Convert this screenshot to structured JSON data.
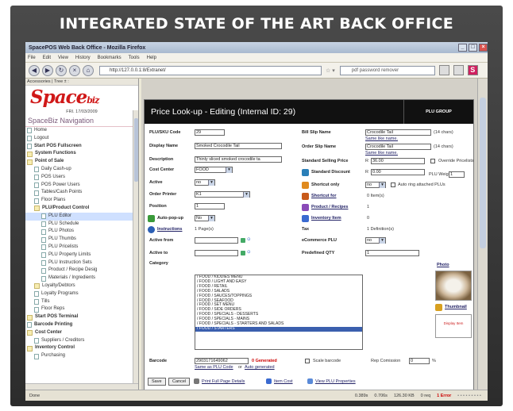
{
  "banner": {
    "title": "INTEGRATED STATE OF THE ART BACK OFFICE"
  },
  "browser": {
    "window_title": "SpacePOS Web Back Office - Mozilla Firefox",
    "menus": [
      "File",
      "Edit",
      "View",
      "History",
      "Bookmarks",
      "Tools",
      "Help"
    ],
    "url": "http://127.0.0.1:8/Extranet/",
    "search": "pdf password remover"
  },
  "sidebar": {
    "header": "Accessories | Tree ± :",
    "logo_main": "Space",
    "logo_sub": "biz",
    "date": "FRI. 17/03/2009",
    "nav_title": "SpaceBiz Navigation",
    "items": [
      {
        "label": "Home",
        "kind": "doc",
        "indent": 1
      },
      {
        "label": "Logout",
        "kind": "doc",
        "indent": 1
      },
      {
        "label": "Start POS Fullscreen",
        "kind": "doc",
        "indent": 1,
        "bold": true
      },
      {
        "label": "System Functions",
        "kind": "folder",
        "indent": 1,
        "bold": true
      },
      {
        "label": "Point of Sale",
        "kind": "folder",
        "indent": 1,
        "bold": true
      },
      {
        "label": "Daily Cash-up",
        "kind": "doc",
        "indent": 2
      },
      {
        "label": "POS Users",
        "kind": "doc",
        "indent": 2
      },
      {
        "label": "POS Power Users",
        "kind": "doc",
        "indent": 2
      },
      {
        "label": "Tables/Cash Points",
        "kind": "doc",
        "indent": 2
      },
      {
        "label": "Floor Plans",
        "kind": "doc",
        "indent": 2
      },
      {
        "label": "PLU/Product Control",
        "kind": "folder",
        "indent": 2,
        "bold": true
      },
      {
        "label": "PLU Editor",
        "kind": "doc",
        "indent": 3,
        "selected": true
      },
      {
        "label": "PLU Schedule",
        "kind": "doc",
        "indent": 3
      },
      {
        "label": "PLU Photos",
        "kind": "doc",
        "indent": 3
      },
      {
        "label": "PLU Thumbs",
        "kind": "doc",
        "indent": 3
      },
      {
        "label": "PLU Pricelists",
        "kind": "doc",
        "indent": 3
      },
      {
        "label": "PLU Property Limits",
        "kind": "doc",
        "indent": 3
      },
      {
        "label": "PLU Instruction Sets",
        "kind": "doc",
        "indent": 3
      },
      {
        "label": "Product / Recipe Desig",
        "kind": "doc",
        "indent": 3
      },
      {
        "label": "Materials / Ingredients",
        "kind": "doc",
        "indent": 3
      },
      {
        "label": "Loyalty/Debtors",
        "kind": "folder",
        "indent": 2
      },
      {
        "label": "Loyalty Programs",
        "kind": "doc",
        "indent": 2
      },
      {
        "label": "Tills",
        "kind": "doc",
        "indent": 2
      },
      {
        "label": "Floor Reps",
        "kind": "doc",
        "indent": 2
      },
      {
        "label": "Start POS Terminal",
        "kind": "folder",
        "indent": 1,
        "bold": true
      },
      {
        "label": "Barcode Printing",
        "kind": "doc",
        "indent": 1,
        "bold": true
      },
      {
        "label": "Cost Center",
        "kind": "folder",
        "indent": 1,
        "bold": true
      },
      {
        "label": "Suppliers / Creditors",
        "kind": "doc",
        "indent": 2
      },
      {
        "label": "Inventory Control",
        "kind": "folder",
        "indent": 1,
        "bold": true
      },
      {
        "label": "Purchasing",
        "kind": "doc",
        "indent": 2
      }
    ]
  },
  "panel": {
    "title": "Price Look-up - Editing (Internal ID: 29)",
    "group_label": "PLU GROUP",
    "fields": {
      "plu_label": "PLU/SKU Code",
      "plu_value": "29",
      "display_label": "Display Name",
      "display_value": "Smoked Crocodile Tail",
      "desc_label": "Description",
      "desc_value": "Thinly sliced smoked crocodile ta",
      "cost_label": "Cost Center",
      "cost_value": "FOOD",
      "active_label": "Active",
      "active_value": "no",
      "printer_label": "Order Printer",
      "printer_value": "K1",
      "position_label": "Position",
      "position_value": "1",
      "autopop_label": "Auto-pop-up",
      "autopop_value": "No",
      "instr_label": "Instructions",
      "instr_value": "1 Page(s)",
      "from_label": "Active from",
      "to_label": "Active to",
      "category_label": "Category",
      "bill_label": "Bill Slip Name",
      "bill_value": "Crocodile Tail",
      "bill_chars": "(14 chars)",
      "bill_same": "Same like name.",
      "order_label": "Order Slip Name",
      "order_value": "Crocodile Tail",
      "order_chars": "(14 chars)",
      "order_same": "Same like name.",
      "ssp_label": "Standard Selling Price",
      "ssp_currency": "R",
      "ssp_value": "36.00",
      "override_label": "Override Pricelists",
      "disc_label": "Standard Discount",
      "disc_currency": "R",
      "disc_value": "0.00",
      "weight_label": "PLU Weight",
      "weight_value": "1",
      "shortcut_label": "Shortcut only",
      "shortcut_value": "no",
      "autoring_label": "Auto ring attached PLUs",
      "shortfor_label": "Shortcut for",
      "shortfor_value": "0 Item(s)",
      "prodrec_label": "Product / Recipes",
      "prodrec_value": "1",
      "inv_label": "Inventory Item",
      "inv_value": "0",
      "tax_label": "Tax",
      "tax_value": "1 Definition(s)",
      "ecom_label": "eCommerce PLU",
      "ecom_value": "no",
      "predef_label": "Predefined QTY",
      "predef_value": "1",
      "photo_label": "Photo",
      "thumb_label": "Thumbnail",
      "thumb_text": "Display Item",
      "barcode_label": "Barcode",
      "barcode_value": "2903171649062",
      "generated": "0 Generated",
      "scale_label": "Scale barcode",
      "same_plu": "Same as PLU Code",
      "or_text": "or",
      "auto_gen": "Auto generated",
      "repcom_label": "Rep Comission",
      "repcom_value": "0",
      "repcom_unit": "%"
    },
    "categories": [
      "/ FOOD / KIDDIES MENU",
      "/ FOOD / LIGHT AND EASY",
      "/ FOOD / RETAIL",
      "/ FOOD / SALADS",
      "/ FOOD / SAUCES/TOPPINGS",
      "/ FOOD / SEAFOOD",
      "/ FOOD / SET MENU",
      "/ FOOD / SIDE ORDERS",
      "/ FOOD / SPECIALS - DESSERTS",
      "/ FOOD / SPECIALS - MAINS",
      "/ FOOD / SPECIALS - STARTERS AND SALADS",
      "/ FOOD / STARTERS"
    ],
    "selected_category": "/ FOOD / STARTERS",
    "buttons": {
      "save": "Save",
      "cancel": "Cancel",
      "print": "Print Full Page Details",
      "item_cost": "Item Cost",
      "view_props": "View PLU Properties"
    }
  },
  "statusbar": {
    "left": "Done",
    "t1": "0.389s",
    "t2": "0.706s",
    "size": "126.30 KB",
    "req": "0 req",
    "errors": "1 Error"
  },
  "colors": {
    "accent_red": "#d01818",
    "panel_header": "#111111",
    "selection": "#3b5fae"
  }
}
